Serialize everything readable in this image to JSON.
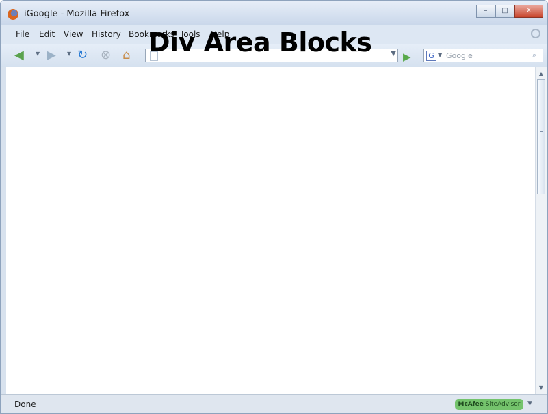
{
  "window": {
    "title": "iGoogle - Mozilla Firefox",
    "controls": [
      "–",
      "□",
      "X"
    ]
  },
  "menu": {
    "items": [
      "File",
      "Edit",
      "View",
      "History",
      "Bookmarks",
      "Tools",
      "Help"
    ]
  },
  "toolbar": {
    "search_placeholder": "Google",
    "search_engine_letter": "G"
  },
  "overlay": {
    "title": "Div Area Blocks"
  },
  "statusbar": {
    "status": "Done",
    "siteadvisor_brand": "McAfee",
    "siteadvisor_label": "SiteAdvisor"
  },
  "colors": {
    "chrome": "#cfdcec",
    "menu": "#dde7f3",
    "status": "#dfe6ef",
    "siteadvisor": "#74c36c"
  },
  "icons": {
    "back": "left-arrow-icon",
    "forward": "right-arrow-icon",
    "reload": "reload-icon",
    "stop": "stop-icon",
    "home": "home-icon",
    "go": "go-arrow-icon",
    "search": "search-icon"
  }
}
